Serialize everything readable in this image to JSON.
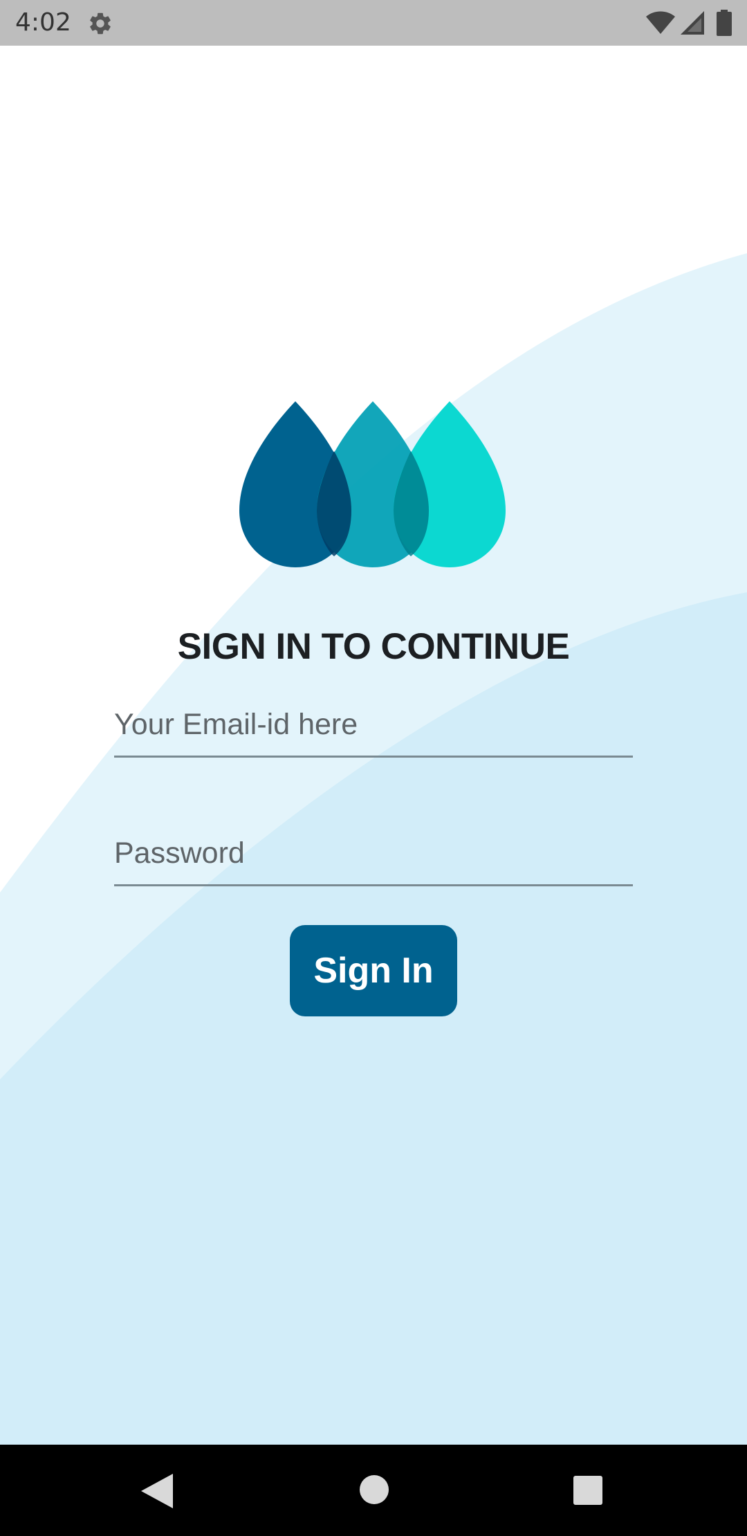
{
  "status_bar": {
    "time": "4:02",
    "icons": [
      "settings-icon",
      "wifi-icon",
      "signal-icon",
      "battery-icon"
    ]
  },
  "logo": {
    "icon": "water-drops-logo",
    "colors": [
      "#00628f",
      "#009fb5",
      "#00d6cf"
    ]
  },
  "title": "SIGN IN TO CONTINUE",
  "form": {
    "email_placeholder": "Your Email-id here",
    "password_placeholder": "Password",
    "signin_label": "Sign In"
  },
  "nav_bar": {
    "icons": [
      "back-icon",
      "home-icon",
      "recents-icon"
    ]
  },
  "colors": {
    "accent": "#00628f",
    "background_light": "#e3f4fb",
    "background_mid": "#d2edf9",
    "status_bar": "#bdbdbd"
  }
}
